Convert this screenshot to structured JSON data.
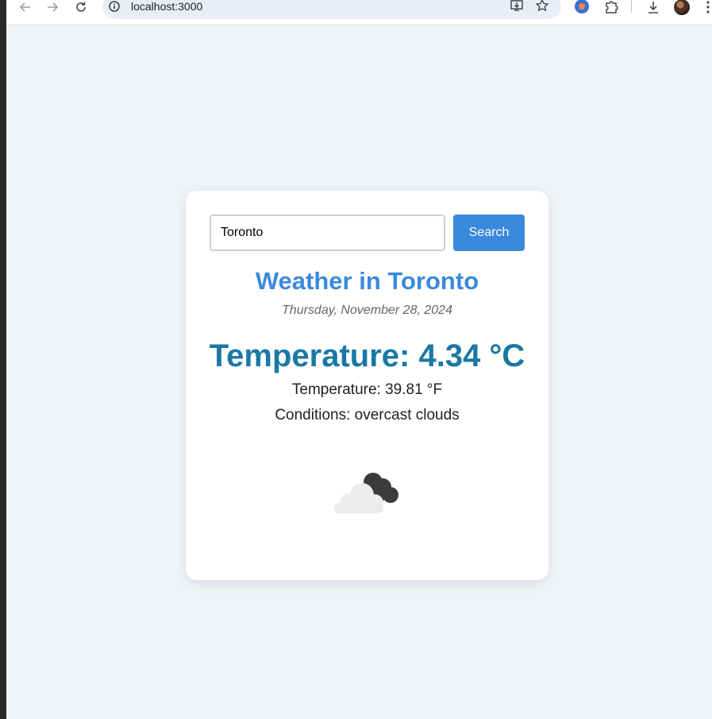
{
  "browser": {
    "url": "localhost:3000"
  },
  "search": {
    "value": "Toronto",
    "button_label": "Search"
  },
  "weather": {
    "title": "Weather in Toronto",
    "date": "Thursday, November 28, 2024",
    "temperature_c": "Temperature: 4.34 °C",
    "temperature_f": "Temperature: 39.81 °F",
    "conditions": "Conditions: overcast clouds",
    "icon": "overcast-clouds-icon"
  },
  "colors": {
    "accent": "#3a89dc",
    "temperature": "#1a78a4",
    "page_bg": "#f0f4f9"
  }
}
